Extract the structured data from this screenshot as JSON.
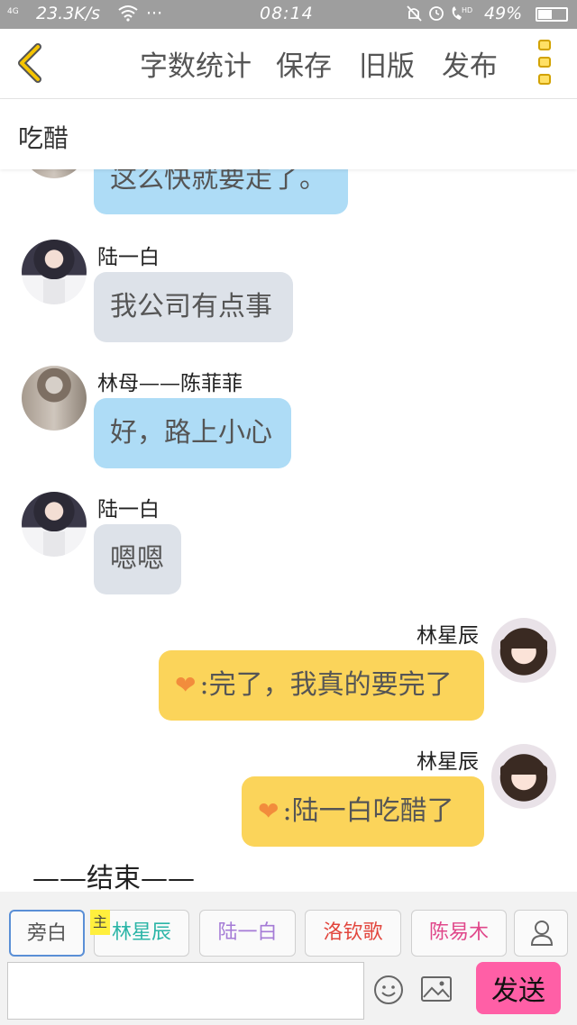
{
  "status_bar": {
    "network": "4G",
    "speed": "23.3K/s",
    "dots": "···",
    "time": "08:14",
    "battery_pct": "49%",
    "battery_level": 0.49,
    "icons": [
      "wifi-icon",
      "mute-icon",
      "alarm-icon",
      "hd-call-icon",
      "battery-icon"
    ]
  },
  "nav": {
    "word_count": "字数统计",
    "save": "保存",
    "old_version": "旧版",
    "publish": "发布",
    "accent": "#f5c400"
  },
  "title": "吃醋",
  "messages": [
    {
      "side": "left",
      "avatar": "mother",
      "sender": "",
      "text": "这么快就要走了。",
      "color": "#aedcf6"
    },
    {
      "side": "left",
      "avatar": "boy",
      "sender": "陆一白",
      "text": "我公司有点事",
      "color": "#dde2e9"
    },
    {
      "side": "left",
      "avatar": "mother",
      "sender": "林母——陈菲菲",
      "text": "好，路上小心",
      "color": "#aedcf6"
    },
    {
      "side": "left",
      "avatar": "boy",
      "sender": "陆一白",
      "text": "嗯嗯",
      "color": "#dde2e9"
    },
    {
      "side": "right",
      "avatar": "girl",
      "sender": "林星辰",
      "text": ":完了，我真的要完了",
      "color": "#fbd45a"
    },
    {
      "side": "right",
      "avatar": "girl",
      "sender": "林星辰",
      "text": ":陆一白吃醋了",
      "color": "#fbd45a"
    }
  ],
  "end_text": "——结束——",
  "characters": [
    {
      "label": "旁白",
      "color": "#555555"
    },
    {
      "label": "林星辰",
      "color": "#2bb5a7"
    },
    {
      "label": "陆一白",
      "color": "#a57bd6"
    },
    {
      "label": "洛钦歌",
      "color": "#e2463d"
    },
    {
      "label": "陈易木",
      "color": "#e0478a"
    }
  ],
  "main_tag": "主",
  "input": {
    "value": "",
    "placeholder": ""
  },
  "send_label": "发送",
  "send_color": "#ff5fa6"
}
